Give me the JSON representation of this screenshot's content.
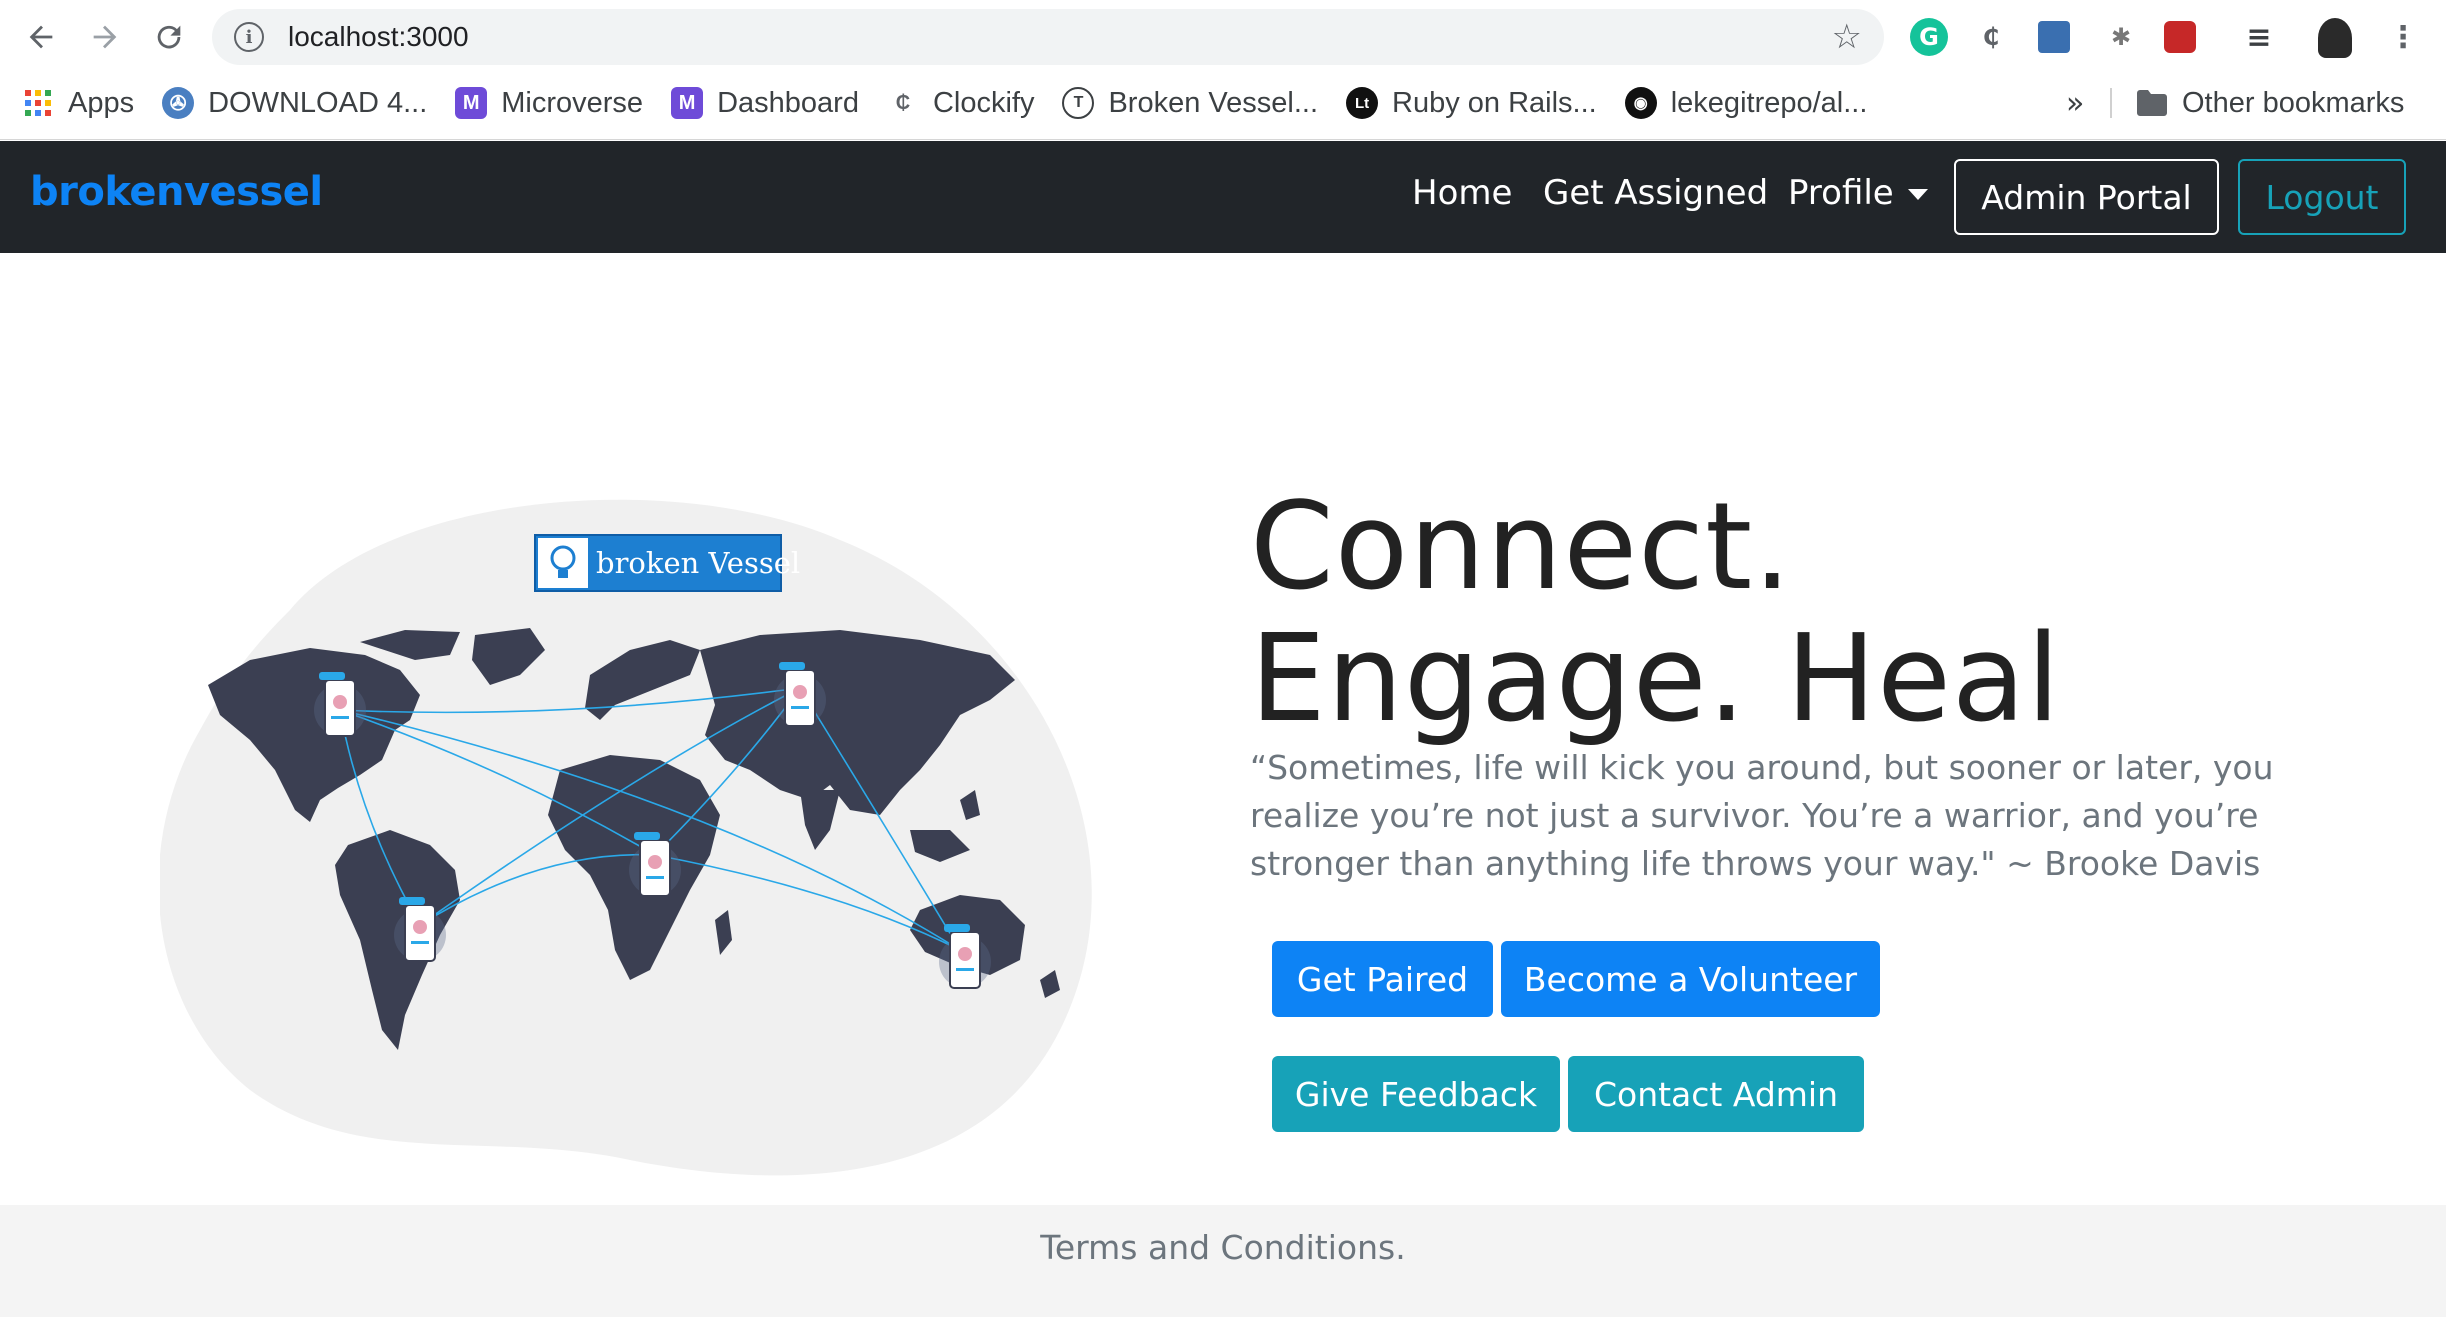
{
  "browser": {
    "url": "localhost:3000",
    "bookmarks": [
      {
        "label": "Apps",
        "icon": "apps-grid-icon"
      },
      {
        "label": "DOWNLOAD 4...",
        "icon": "film-reel-icon"
      },
      {
        "label": "Microverse",
        "icon": "microverse-icon"
      },
      {
        "label": "Dashboard",
        "icon": "microverse-icon"
      },
      {
        "label": "Clockify",
        "icon": "clockify-icon"
      },
      {
        "label": "Broken Vessel...",
        "icon": "t-circle-icon"
      },
      {
        "label": "Ruby on Rails...",
        "icon": "lt-circle-icon"
      },
      {
        "label": "lekegitrepo/al...",
        "icon": "github-icon"
      }
    ],
    "more_label": "»",
    "other_bookmarks": "Other bookmarks"
  },
  "navbar": {
    "brand": "brokenvessel",
    "home": "Home",
    "get_assigned": "Get Assigned",
    "profile": "Profile",
    "admin_portal": "Admin Portal",
    "logout": "Logout"
  },
  "hero": {
    "logo_text": "broken Vessel",
    "headline_line1": "Connect.",
    "headline_line2": "Engage. Heal",
    "quote": "“Sometimes, life will kick you around, but sooner or later, you realize you’re not just a survivor. You’re a warrior, and you’re stronger than anything life throws your way.\" ~ Brooke Davis",
    "buttons": {
      "get_paired": "Get Paired",
      "become_volunteer": "Become a Volunteer",
      "give_feedback": "Give Feedback",
      "contact_admin": "Contact Admin"
    }
  },
  "footer": {
    "terms": "Terms and Conditions."
  },
  "colors": {
    "primary": "#0d83f5",
    "info": "#17a2b8",
    "navbar_bg": "#212529",
    "map_land": "#3b3f52",
    "blob_bg": "#f0f0f0"
  }
}
